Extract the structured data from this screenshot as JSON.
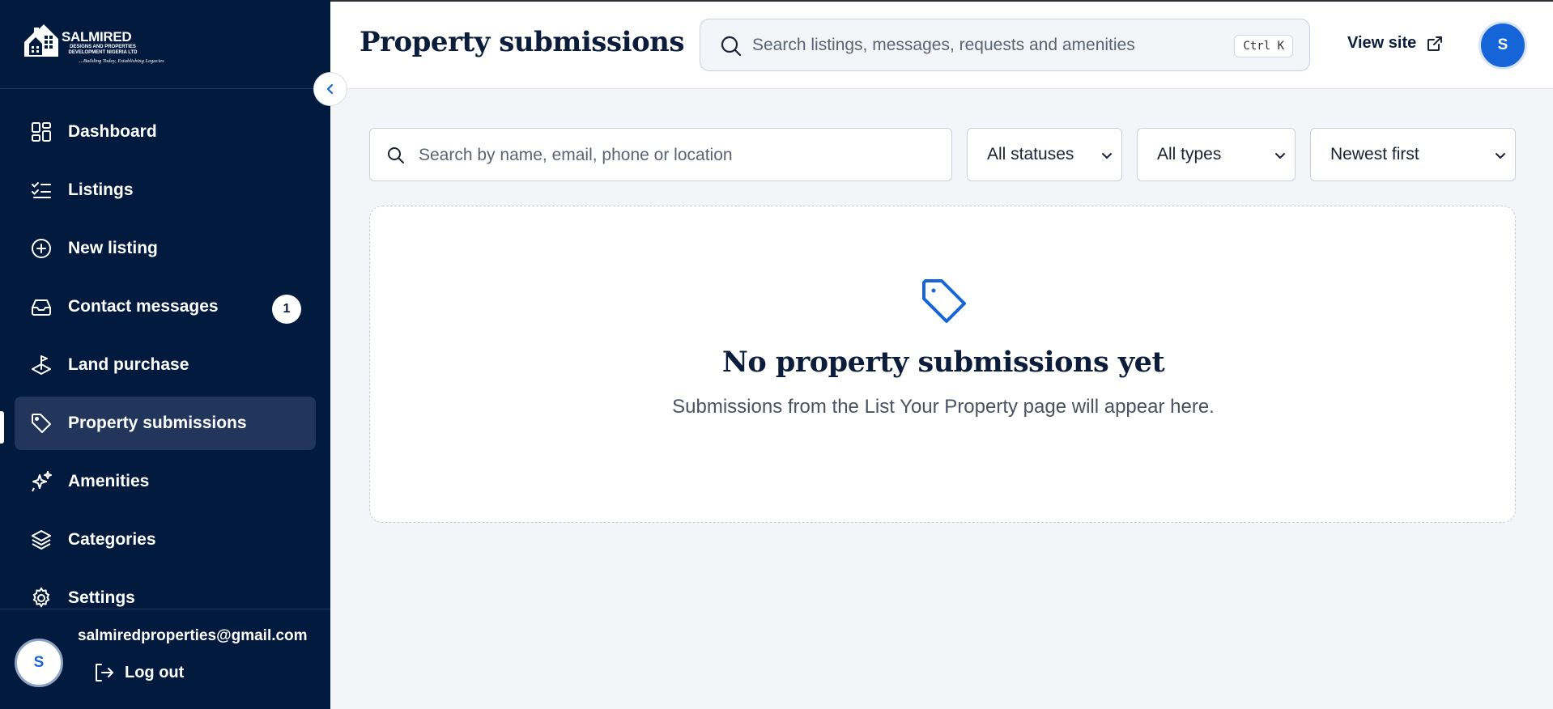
{
  "brand": {
    "name": "SALMIRED",
    "subtitle": "DESIGNS AND PROPERTIES DEVELOPMENT NIGERIA LTD",
    "tagline": "...Building Today, Establishing Legacies"
  },
  "sidebar": {
    "items": [
      {
        "label": "Dashboard",
        "icon": "grid-icon"
      },
      {
        "label": "Listings",
        "icon": "list-check-icon"
      },
      {
        "label": "New listing",
        "icon": "plus-circle-icon"
      },
      {
        "label": "Contact messages",
        "icon": "inbox-icon",
        "badge": "1"
      },
      {
        "label": "Land purchase",
        "icon": "land-icon"
      },
      {
        "label": "Property submissions",
        "icon": "tag-icon",
        "active": true
      },
      {
        "label": "Amenities",
        "icon": "sparkles-icon"
      },
      {
        "label": "Categories",
        "icon": "layers-icon"
      },
      {
        "label": "Settings",
        "icon": "gear-icon"
      }
    ],
    "user": {
      "avatar_initial": "S",
      "email": "salmiredproperties@gmail.com"
    },
    "logout_label": "Log out"
  },
  "header": {
    "title": "Property submissions",
    "search_placeholder": "Search listings, messages, requests and amenities",
    "shortcut": "Ctrl K",
    "view_site_label": "View site",
    "avatar_initial": "S"
  },
  "filters": {
    "search_placeholder": "Search by name, email, phone or location",
    "status_value": "All statuses",
    "type_value": "All types",
    "sort_value": "Newest first"
  },
  "empty_state": {
    "title": "No property submissions yet",
    "subtitle": "Submissions from the List Your Property page will appear here."
  },
  "colors": {
    "sidebar_bg": "#031a3f",
    "active_item_bg": "#21365a",
    "accent": "#1565d8",
    "page_bg": "#f3f5f9"
  }
}
